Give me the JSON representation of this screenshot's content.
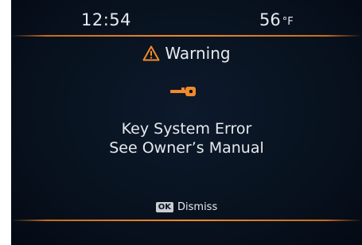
{
  "status_bar": {
    "time": "12:54",
    "temperature": "56",
    "temperature_unit": "°F"
  },
  "alert": {
    "title": "Warning",
    "icon": "warning-triangle-icon",
    "symbol": "key-icon",
    "message_line1": "Key System Error",
    "message_line2": "See Owner’s Manual"
  },
  "dismiss": {
    "key_label": "OK",
    "label": "Dismiss"
  },
  "colors": {
    "accent": "#f08a2a",
    "background": "#08121f",
    "text": "#e6e9ee"
  }
}
